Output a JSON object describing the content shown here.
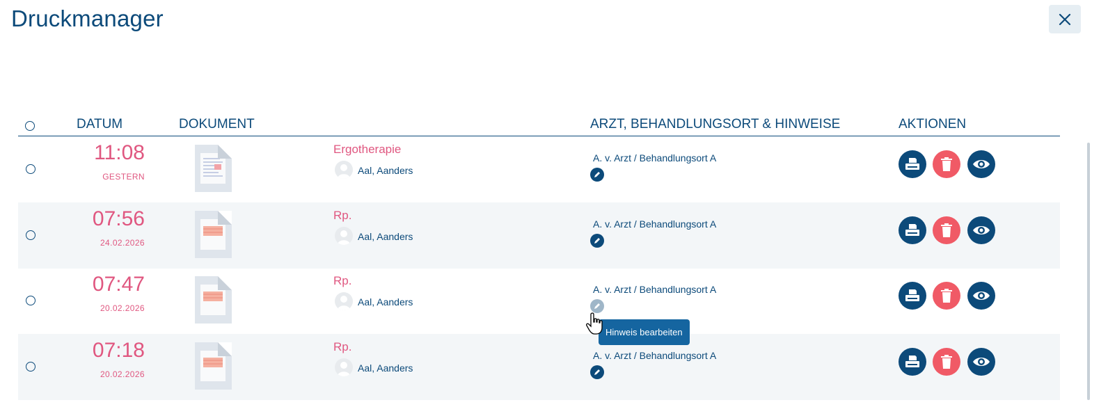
{
  "dialog": {
    "title": "Druckmanager"
  },
  "icons": {
    "close": "close-icon",
    "edit": "pencil-icon",
    "print": "printer-icon",
    "delete": "trash-icon",
    "view": "eye-icon",
    "avatar": "user-avatar-icon"
  },
  "colors": {
    "primary": "#0c4a7a",
    "accent": "#e05780",
    "danger": "#f05a66",
    "tooltip": "#1565a0"
  },
  "table": {
    "headers": {
      "datum": "DATUM",
      "dokument": "DOKUMENT",
      "arzt": "ARZT, BEHANDLUNGSORT & HINWEISE",
      "aktionen": "AKTIONEN"
    },
    "rows": [
      {
        "time": "11:08",
        "date": "GESTERN",
        "doc_type": "Ergotherapie",
        "patient": "Aal, Aanders",
        "arzt": "A. v. Arzt / Behandlungsort A"
      },
      {
        "time": "07:56",
        "date": "24.02.2026",
        "doc_type": "Rp.",
        "patient": "Aal, Aanders",
        "arzt": "A. v. Arzt / Behandlungsort A"
      },
      {
        "time": "07:47",
        "date": "20.02.2026",
        "doc_type": "Rp.",
        "patient": "Aal, Aanders",
        "arzt": "A. v. Arzt / Behandlungsort A"
      },
      {
        "time": "07:18",
        "date": "20.02.2026",
        "doc_type": "Rp.",
        "patient": "Aal, Aanders",
        "arzt": "A. v. Arzt / Behandlungsort A"
      }
    ]
  },
  "tooltip": {
    "text": "Hinweis bearbeiten"
  }
}
